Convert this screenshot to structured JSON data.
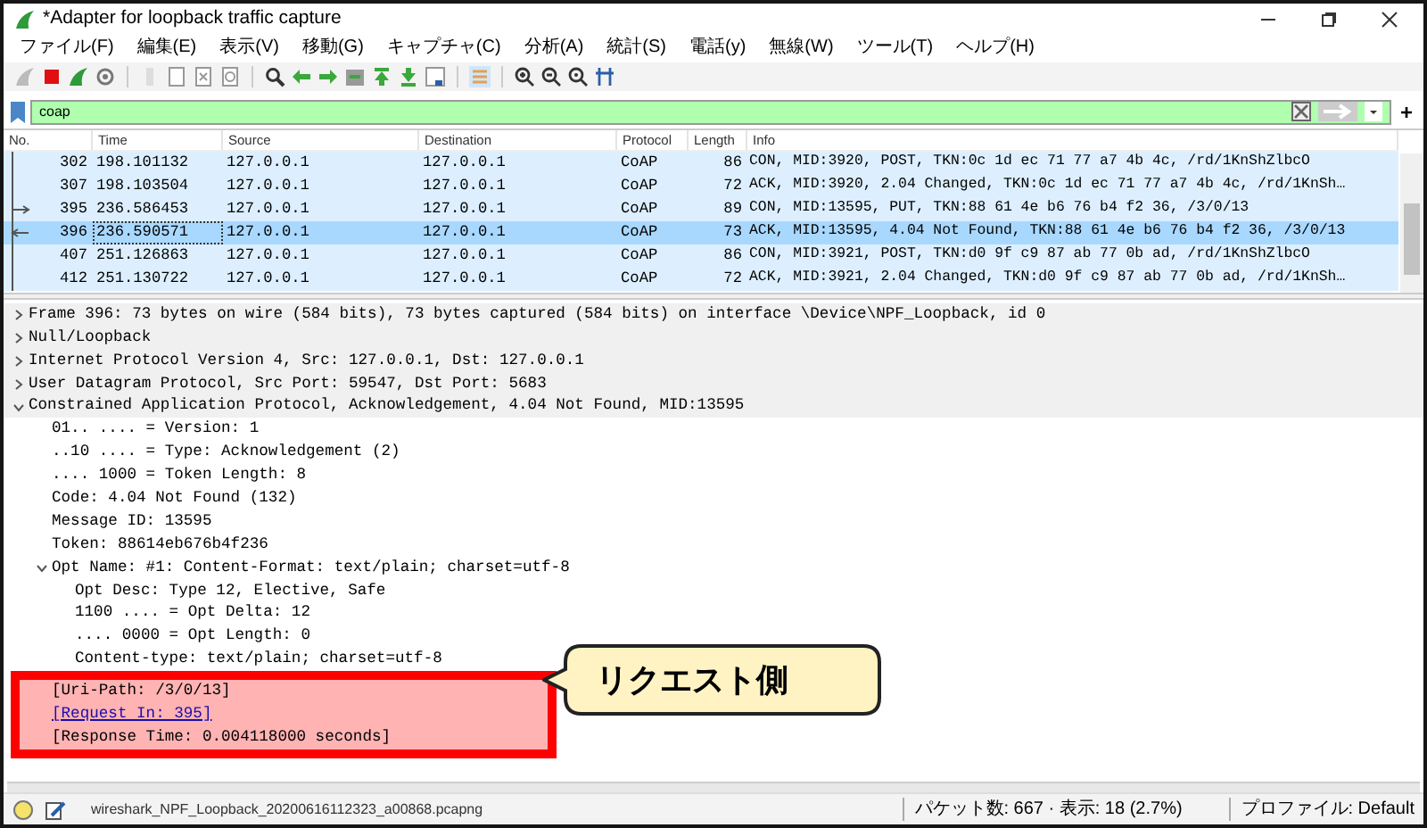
{
  "window": {
    "title": "*Adapter for loopback traffic capture"
  },
  "menu": [
    "ファイル(F)",
    "編集(E)",
    "表示(V)",
    "移動(G)",
    "キャプチャ(C)",
    "分析(A)",
    "統計(S)",
    "電話(y)",
    "無線(W)",
    "ツール(T)",
    "ヘルプ(H)"
  ],
  "filter": {
    "value": "coap",
    "add_button": "+"
  },
  "packet_list": {
    "columns": [
      "No.",
      "Time",
      "Source",
      "Destination",
      "Protocol",
      "Length",
      "Info"
    ],
    "rows": [
      {
        "no": "302",
        "time": "198.101132",
        "source": "127.0.0.1",
        "destination": "127.0.0.1",
        "protocol": "CoAP",
        "length": "86",
        "info": "CON, MID:3920, POST, TKN:0c 1d ec 71 77 a7 4b 4c, /rd/1KnShZlbcO",
        "selected": false,
        "kind": "member"
      },
      {
        "no": "307",
        "time": "198.103504",
        "source": "127.0.0.1",
        "destination": "127.0.0.1",
        "protocol": "CoAP",
        "length": "72",
        "info": "ACK, MID:3920, 2.04 Changed, TKN:0c 1d ec 71 77 a7 4b 4c, /rd/1KnSh…",
        "selected": false,
        "kind": "member"
      },
      {
        "no": "395",
        "time": "236.586453",
        "source": "127.0.0.1",
        "destination": "127.0.0.1",
        "protocol": "CoAP",
        "length": "89",
        "info": "CON, MID:13595, PUT, TKN:88 61 4e b6 76 b4 f2 36, /3/0/13",
        "selected": false,
        "kind": "request"
      },
      {
        "no": "396",
        "time": "236.590571",
        "source": "127.0.0.1",
        "destination": "127.0.0.1",
        "protocol": "CoAP",
        "length": "73",
        "info": "ACK, MID:13595, 4.04 Not Found, TKN:88 61 4e b6 76 b4 f2 36, /3/0/13",
        "selected": true,
        "kind": "response"
      },
      {
        "no": "407",
        "time": "251.126863",
        "source": "127.0.0.1",
        "destination": "127.0.0.1",
        "protocol": "CoAP",
        "length": "86",
        "info": "CON, MID:3921, POST, TKN:d0 9f c9 87 ab 77 0b ad, /rd/1KnShZlbcO",
        "selected": false,
        "kind": "member"
      },
      {
        "no": "412",
        "time": "251.130722",
        "source": "127.0.0.1",
        "destination": "127.0.0.1",
        "protocol": "CoAP",
        "length": "72",
        "info": "ACK, MID:3921, 2.04 Changed, TKN:d0 9f c9 87 ab 77 0b ad, /rd/1KnSh…",
        "selected": false,
        "kind": "member"
      }
    ]
  },
  "details": [
    {
      "label": "Frame 396: 73 bytes on wire (584 bits), 73 bytes captured (584 bits) on interface \\Device\\NPF_Loopback, id 0",
      "expanded": false
    },
    {
      "label": "Null/Loopback",
      "expanded": false
    },
    {
      "label": "Internet Protocol Version 4, Src: 127.0.0.1, Dst: 127.0.0.1",
      "expanded": false
    },
    {
      "label": "User Datagram Protocol, Src Port: 59547, Dst Port: 5683",
      "expanded": false
    },
    {
      "label": "Constrained Application Protocol, Acknowledgement, 4.04 Not Found, MID:13595",
      "expanded": true,
      "children": [
        {
          "label": "01.. .... = Version: 1",
          "highlighted": false
        },
        {
          "label": "..10 .... = Type: Acknowledgement (2)",
          "highlighted": false
        },
        {
          "label": ".... 1000 = Token Length: 8",
          "highlighted": false
        },
        {
          "label": "Code: 4.04 Not Found (132)",
          "highlighted": false
        },
        {
          "label": "Message ID: 13595",
          "highlighted": false
        },
        {
          "label": "Token: 88614eb676b4f236",
          "highlighted": false
        },
        {
          "label": "Opt Name: #1: Content-Format: text/plain; charset=utf-8",
          "expanded": true,
          "highlighted": false,
          "children": [
            {
              "label": "Opt Desc: Type 12, Elective, Safe"
            },
            {
              "label": "1100 .... = Opt Delta: 12"
            },
            {
              "label": ".... 0000 = Opt Length: 0"
            },
            {
              "label": "Content-type: text/plain; charset=utf-8"
            }
          ]
        },
        {
          "label": "[Uri-Path: /3/0/13]",
          "highlighted": true
        },
        {
          "label": "[Request In: 395]",
          "kind": "link",
          "highlighted": true
        },
        {
          "label": "[Response Time: 0.004118000 seconds]",
          "highlighted": true
        }
      ]
    }
  ],
  "callout": {
    "text": "リクエスト側"
  },
  "status_bar": {
    "file": "wireshark_NPF_Loopback_20200616112323_a00868.pcapng",
    "packets": "パケット数: 667 · 表示: 18 (2.7%)",
    "profile": "プロファイル: Default"
  }
}
